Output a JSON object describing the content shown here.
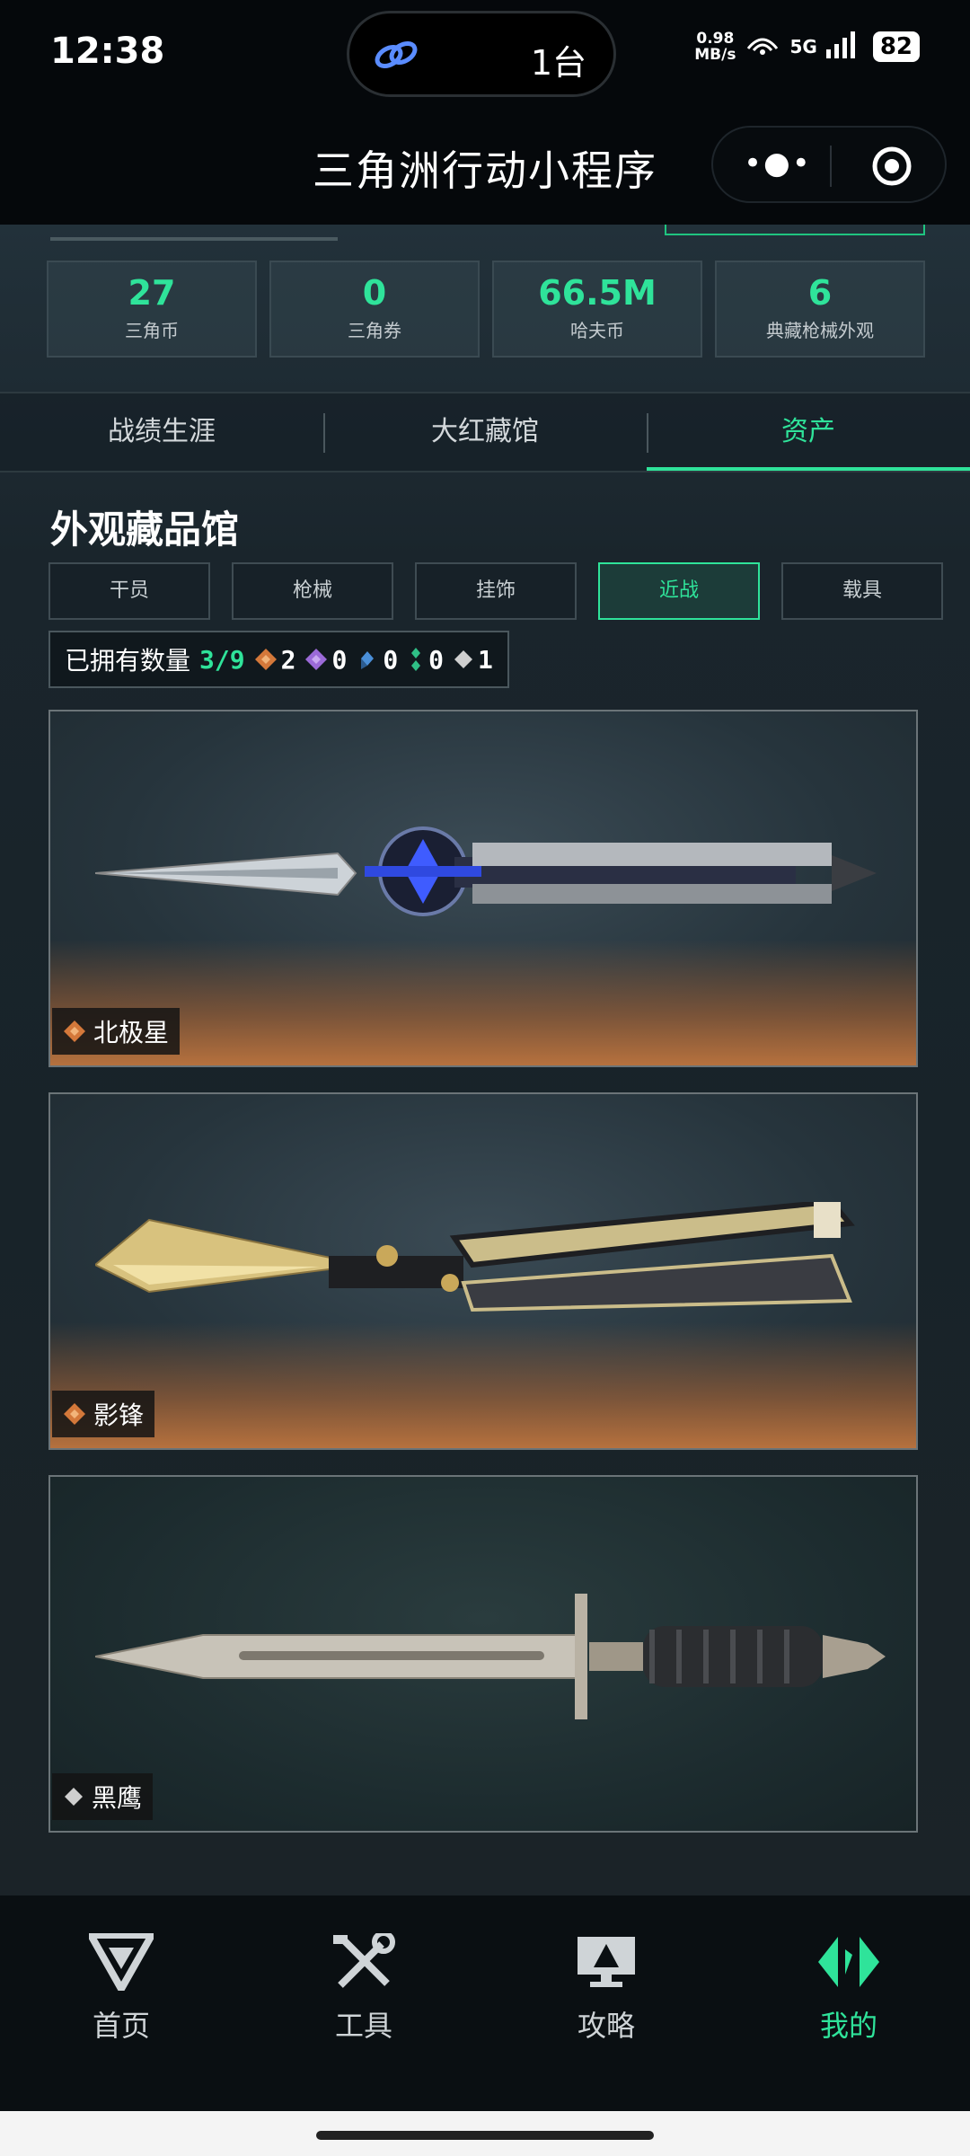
{
  "status_bar": {
    "time": "12:38",
    "island_count": "1台",
    "net_speed_value": "0.98",
    "net_speed_unit": "MB/s",
    "signal": "5G",
    "battery": "82"
  },
  "title_bar": {
    "title": "三角洲行动小程序",
    "more_icon": "more-dots-icon",
    "close_icon": "target-icon"
  },
  "stats": [
    {
      "value": "27",
      "label": "三角币"
    },
    {
      "value": "0",
      "label": "三角券"
    },
    {
      "value": "66.5M",
      "label": "哈夫币"
    },
    {
      "value": "6",
      "label": "典藏枪械外观"
    }
  ],
  "tabs": [
    {
      "label": "战绩生涯",
      "active": false
    },
    {
      "label": "大红藏馆",
      "active": false
    },
    {
      "label": "资产",
      "active": true
    }
  ],
  "section_title": "外观藏品馆",
  "filters": [
    {
      "label": "干员",
      "active": false
    },
    {
      "label": "枪械",
      "active": false
    },
    {
      "label": "挂饰",
      "active": false
    },
    {
      "label": "近战",
      "active": true
    },
    {
      "label": "载具",
      "active": false
    }
  ],
  "owned": {
    "label": "已拥有数量",
    "count": "3/9",
    "rarities": [
      {
        "icon": "orange-diamond-icon",
        "color": "#d4783a",
        "count": "2"
      },
      {
        "icon": "purple-diamond-icon",
        "color": "#9b6ad8",
        "count": "0"
      },
      {
        "icon": "blue-diamond-icon",
        "color": "#4a8fd8",
        "count": "0"
      },
      {
        "icon": "green-diamond-icon",
        "color": "#2fbf86",
        "count": "0"
      },
      {
        "icon": "white-diamond-icon",
        "color": "#cfcfcf",
        "count": "1"
      }
    ]
  },
  "items": [
    {
      "name": "北极星",
      "rarity_color": "#d4783a"
    },
    {
      "name": "影锋",
      "rarity_color": "#d4783a"
    },
    {
      "name": "黑鹰",
      "rarity_color": "#cfcfcf"
    }
  ],
  "bottom_nav": [
    {
      "label": "首页",
      "icon": "delta-logo-icon",
      "active": false
    },
    {
      "label": "工具",
      "icon": "tools-icon",
      "active": false
    },
    {
      "label": "攻略",
      "icon": "guide-icon",
      "active": false
    },
    {
      "label": "我的",
      "icon": "profile-icon",
      "active": true
    }
  ],
  "colors": {
    "accent": "#2fe39a",
    "background": "#0b1014"
  }
}
